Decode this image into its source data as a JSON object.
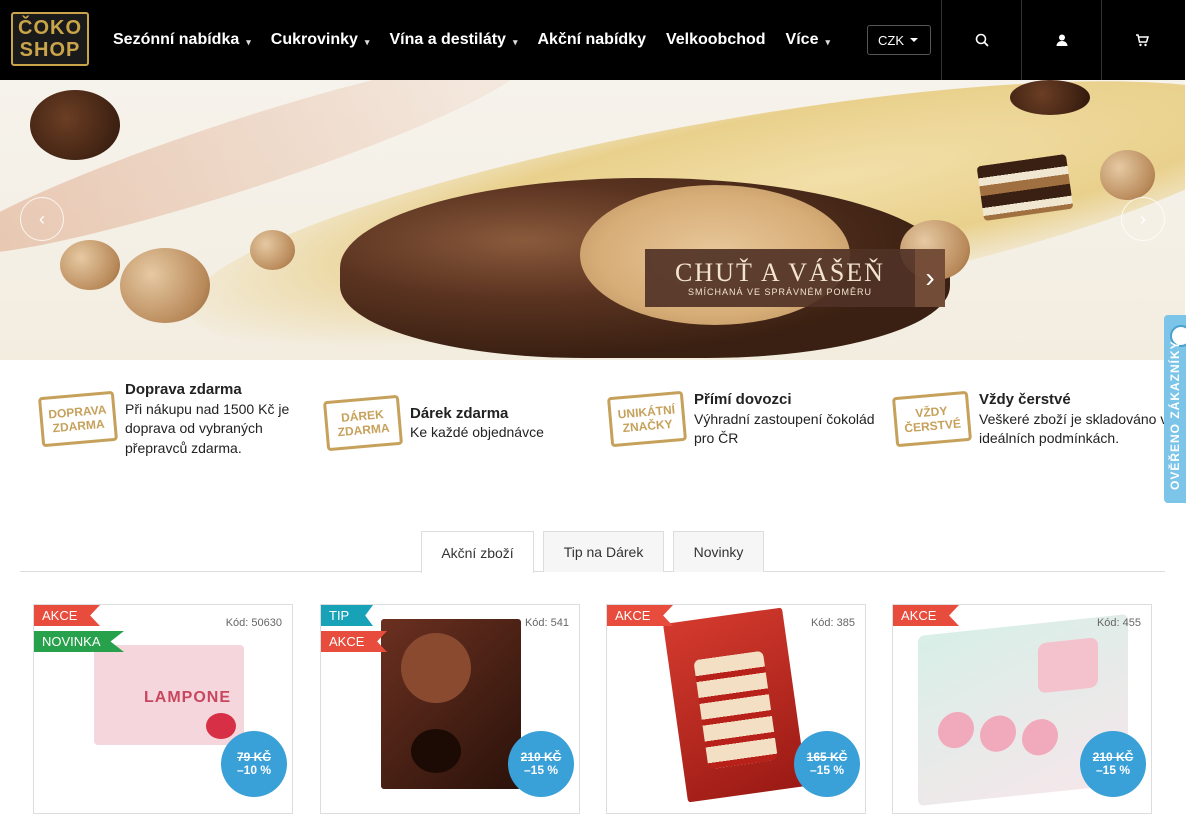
{
  "logo": {
    "line1": "ČOKO",
    "line2": "SHOP"
  },
  "nav": [
    {
      "label": "Sezónní nabídka",
      "has_caret": true
    },
    {
      "label": "Cukrovinky",
      "has_caret": true
    },
    {
      "label": "Vína a destiláty",
      "has_caret": true
    },
    {
      "label": "Akční nabídky",
      "has_caret": false
    },
    {
      "label": "Velkoobchod",
      "has_caret": false
    },
    {
      "label": "Více",
      "has_caret": true
    }
  ],
  "currency": "CZK",
  "header_icons": [
    "search-icon",
    "user-icon",
    "cart-icon"
  ],
  "hero": {
    "headline": "CHUŤ A VÁŠEŇ",
    "subline": "SMÍCHANÁ VE SPRÁVNÉM POMĚRU"
  },
  "benefits": [
    {
      "badge1": "DOPRAVA",
      "badge2": "ZDARMA",
      "title": "Doprava zdarma",
      "text": "Při nákupu nad 1500 Kč je doprava od vybraných přepravců zdarma."
    },
    {
      "badge1": "DÁREK",
      "badge2": "ZDARMA",
      "title": "Dárek zdarma",
      "text": "Ke každé objednávce"
    },
    {
      "badge1": "UNIKÁTNÍ",
      "badge2": "ZNAČKY",
      "title": "Přímí dovozci",
      "text": "Výhradní zastoupení čokolád pro ČR"
    },
    {
      "badge1": "VŽDY",
      "badge2": "ČERSTVÉ",
      "title": "Vždy čerstvé",
      "text": "Veškeré zboží je skladováno v ideálních podmínkách."
    }
  ],
  "side_tab": "OVĚŘENO ZÁKAZNÍKY",
  "tabs": [
    {
      "label": "Akční zboží",
      "active": true
    },
    {
      "label": "Tip na Dárek",
      "active": false
    },
    {
      "label": "Novinky",
      "active": false
    }
  ],
  "products": [
    {
      "flags": [
        "AKCE",
        "NOVINKA"
      ],
      "code": "Kód: 50630",
      "old_price": "79 KČ",
      "discount": "–10 %",
      "accent": "#e9677a"
    },
    {
      "flags": [
        "TIP",
        "AKCE"
      ],
      "code": "Kód: 541",
      "old_price": "210 KČ",
      "discount": "–15 %",
      "accent": "#5a2a1c"
    },
    {
      "flags": [
        "AKCE"
      ],
      "code": "Kód: 385",
      "old_price": "165 KČ",
      "discount": "–15 %",
      "accent": "#c0302c"
    },
    {
      "flags": [
        "AKCE"
      ],
      "code": "Kód: 455",
      "old_price": "210 KČ",
      "discount": "–15 %",
      "accent": "#f0a8b8"
    }
  ]
}
